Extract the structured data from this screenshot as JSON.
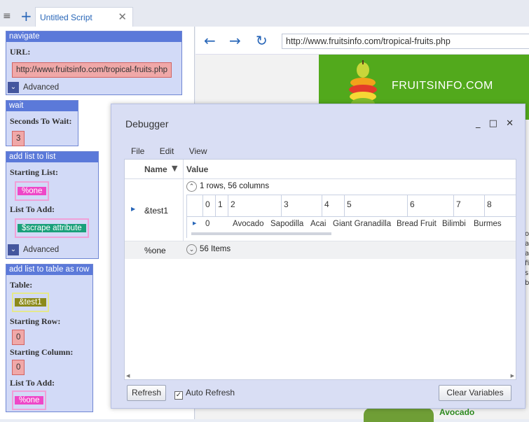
{
  "tab": {
    "title": "Untitled Script",
    "close": "✕",
    "new_tab": "+",
    "menu": "≡"
  },
  "blocks": {
    "navigate": {
      "title": "navigate",
      "url_label": "URL:",
      "url_value": "http://www.fruitsinfo.com/tropical-fruits.php",
      "advanced": "Advanced"
    },
    "wait": {
      "title": "wait",
      "seconds_label": "Seconds To Wait:",
      "seconds_value": "3"
    },
    "add_list": {
      "title": "add list to list",
      "starting_label": "Starting List:",
      "starting_value": "%one",
      "list_to_add_label": "List To Add:",
      "list_to_add_value": "$scrape attribute",
      "advanced": "Advanced"
    },
    "add_table": {
      "title": "add list to table as row",
      "table_label": "Table:",
      "table_value": "&test1",
      "row_label": "Starting Row:",
      "row_value": "0",
      "col_label": "Starting Column:",
      "col_value": "0",
      "list_label": "List To Add:",
      "list_value": "%one"
    }
  },
  "browser": {
    "url": "http://www.fruitsinfo.com/tropical-fruits.php",
    "banner": "FRUITSINFO.COM",
    "right_snips": [
      "o",
      "a",
      "a",
      "fi",
      "s",
      "b"
    ],
    "avocado": "Avocado"
  },
  "debugger": {
    "title": "Debugger",
    "controls": "_ □ ✕",
    "menu": [
      "File",
      "Edit",
      "View"
    ],
    "headers": {
      "name": "Name",
      "value": "Value"
    },
    "rows": [
      {
        "name": "&test1",
        "summary": "1 rows, 56 columns",
        "columns": [
          "0",
          "1",
          "2",
          "3",
          "4",
          "5",
          "6",
          "7",
          "8"
        ],
        "row_index": "0",
        "cells": [
          "Avocado",
          "Sapodilla",
          "Acai",
          "Giant Granadilla",
          "Bread Fruit",
          "Bilimbi",
          "Burmes"
        ]
      },
      {
        "name": "%one",
        "summary": "56 Items"
      }
    ],
    "refresh": "Refresh",
    "auto_refresh": "Auto Refresh",
    "auto_refresh_checked": "✓",
    "clear": "Clear Variables"
  },
  "colors": {
    "accent": "#2866b8",
    "block_header": "#5b79d9",
    "banner_green": "#52a91c"
  }
}
